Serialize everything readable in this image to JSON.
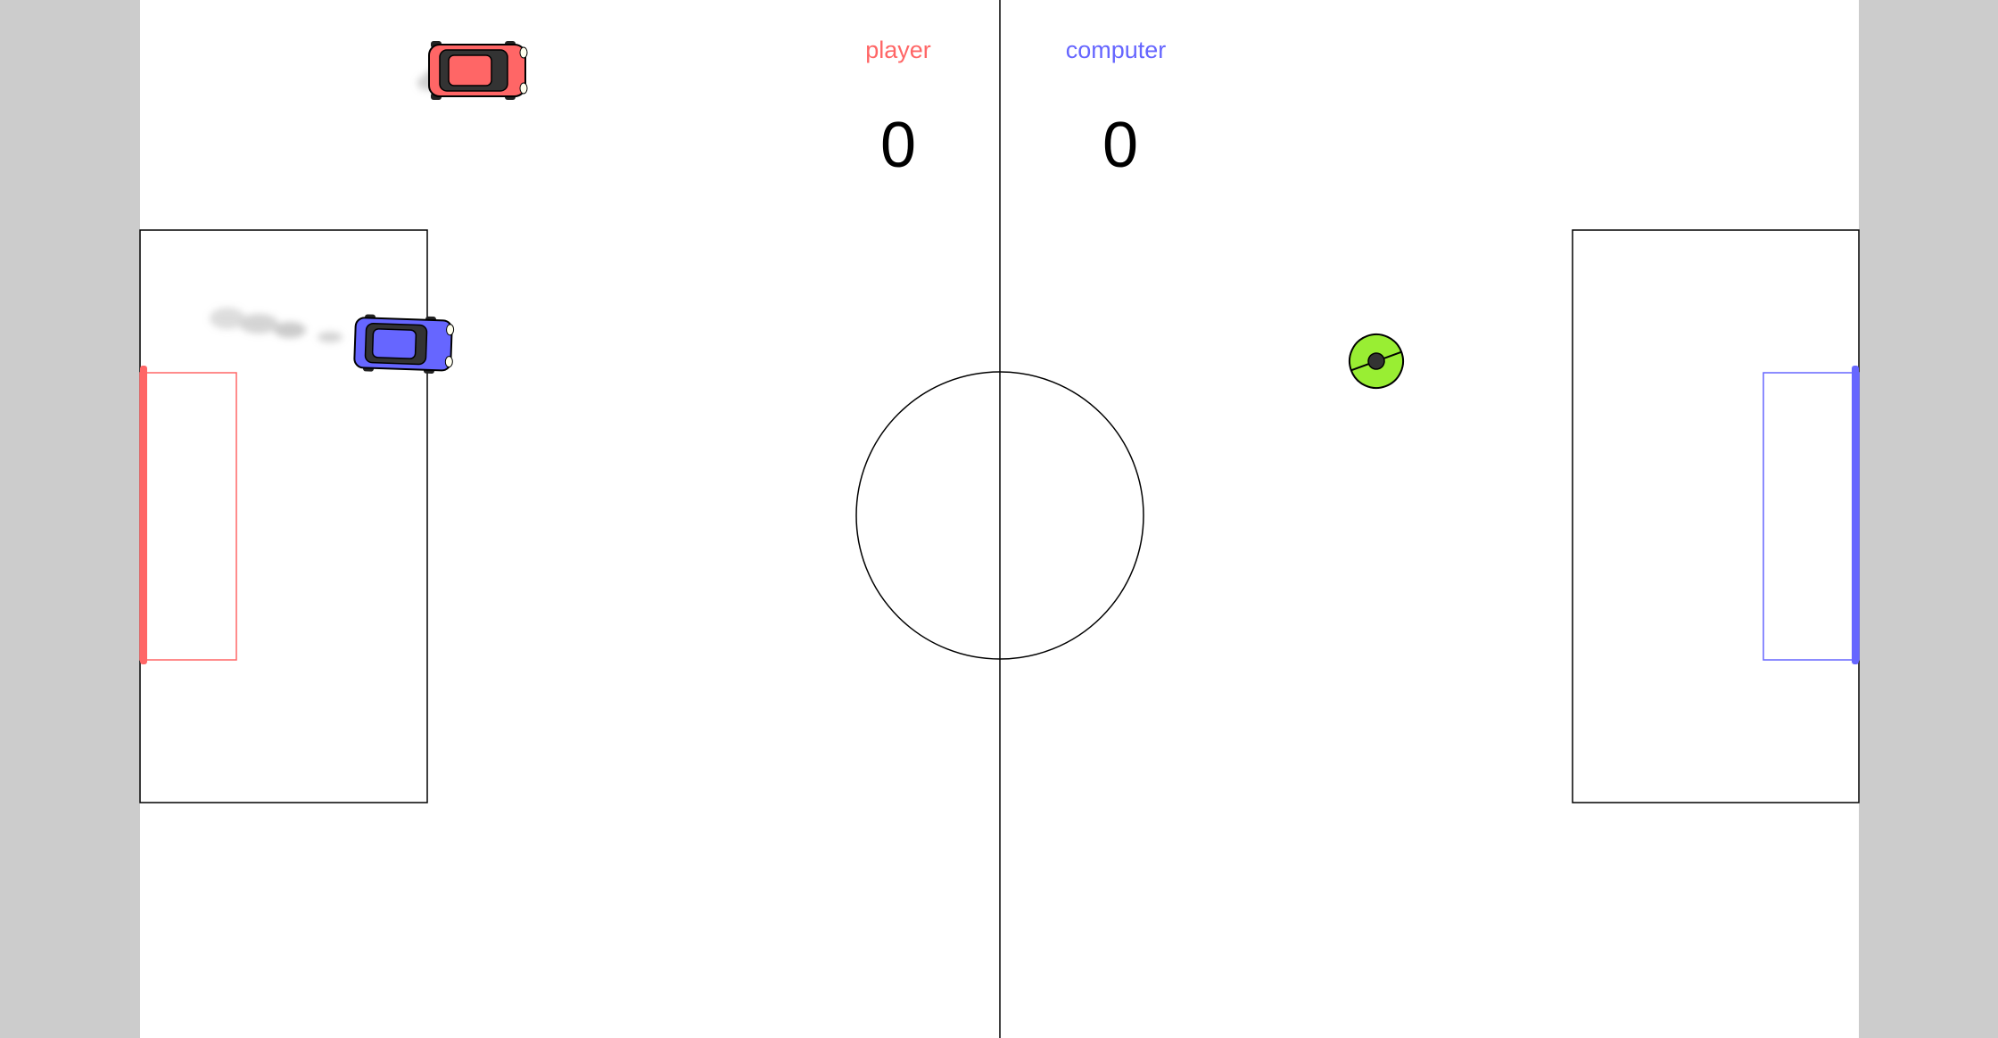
{
  "scoreboard": {
    "player": {
      "label": "player",
      "score": "0",
      "color": "#ff6666"
    },
    "computer": {
      "label": "computer",
      "score": "0",
      "color": "#6666ff"
    }
  },
  "colors": {
    "background": "#cccccc",
    "field": "#ffffff",
    "lines": "#000000",
    "player_goal": "#ff6666",
    "computer_goal": "#6666ff",
    "ball": "#99ee33",
    "ball_center": "#333333"
  },
  "entities": {
    "player_car": {
      "color": "#ff6666",
      "direction": "right"
    },
    "computer_car": {
      "color": "#6666ff",
      "direction": "right"
    },
    "ball": {
      "color": "#99ee33"
    }
  }
}
